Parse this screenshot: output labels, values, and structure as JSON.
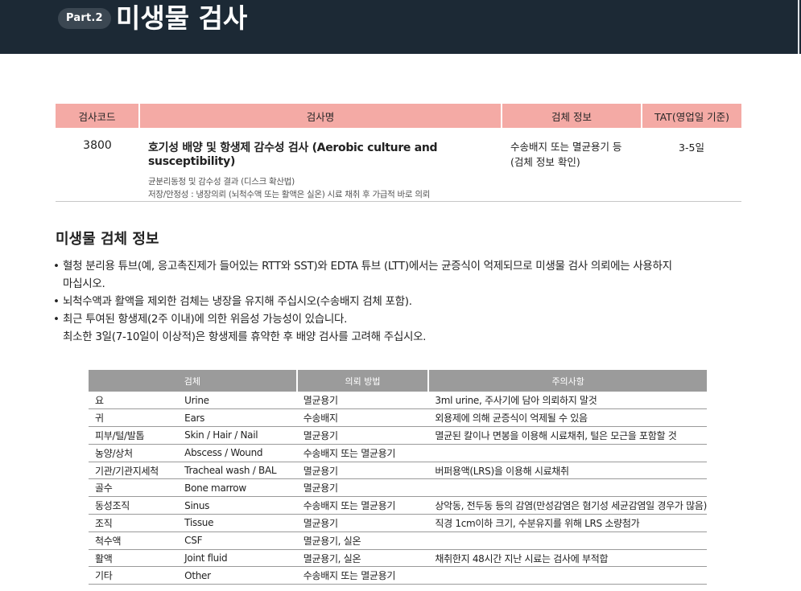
{
  "header": {
    "badge": "Part.2",
    "title": "미생물 검사"
  },
  "test_table": {
    "headers": [
      "검사코드",
      "검사명",
      "검체 정보",
      "TAT(영업일 기준)"
    ],
    "row": {
      "code": "3800",
      "name": "호기성 배양 및 항생제 감수성 검사 (Aerobic culture and susceptibility)",
      "sub1": "균분리동정 및 감수성 결과 (디스크 확산법)",
      "sub2": "저장/안정성 : 냉장의뢰 (뇌척수액 또는 활액은 실온) 시료 채취 후 가급적 바로 의뢰",
      "spec1": "수송배지 또는 멸균용기 등",
      "spec2": "(검체 정보 확인)",
      "tat": "3-5일"
    }
  },
  "section": {
    "heading": "미생물 검체 정보",
    "notes": [
      {
        "bullet": "•",
        "line1": "혈청 분리용 튜브(예, 응고촉진제가 들어있는 RTT와 SST)와 EDTA 튜브 (LTT)에서는 균증식이 억제되므로 미생물 검사 의뢰에는 사용하지",
        "line2": "마십시오."
      },
      {
        "bullet": "•",
        "line1": "뇌척수액과 활액을 제외한 검체는 냉장을 유지해 주십시오(수송배지 검체 포함).",
        "line2": ""
      },
      {
        "bullet": "•",
        "line1": "최근 투여된 항생제(2주 이내)에 의한 위음성 가능성이 있습니다.",
        "line2": "최소한 3일(7-10일이 이상적)은 항생제를 휴약한 후 배양 검사를 고려해 주십시오."
      }
    ]
  },
  "spec_table": {
    "headers": [
      "검체",
      "의뢰 방법",
      "주의사항"
    ],
    "rows": [
      {
        "ko": "요",
        "en": "Urine",
        "method": "멸균용기",
        "note": "3ml urine, 주사기에 담아 의뢰하지 말것"
      },
      {
        "ko": "귀",
        "en": "Ears",
        "method": "수송배지",
        "note": "외용제에 의해 균증식이 억제될 수 있음"
      },
      {
        "ko": "피부/털/발톱",
        "en": "Skin / Hair / Nail",
        "method": "멸균용기",
        "note": "멸균된 칼이나 면봉을 이용해 시료채취, 털은 모근을 포함할 것"
      },
      {
        "ko": "농양/상처",
        "en": "Abscess / Wound",
        "method": "수송배지 또는 멸균용기",
        "note": ""
      },
      {
        "ko": "기관/기관지세척",
        "en": "Tracheal wash / BAL",
        "method": "멸균용기",
        "note": "버퍼용액(LRS)을 이용해 시료채취"
      },
      {
        "ko": "골수",
        "en": "Bone marrow",
        "method": "멸균용기",
        "note": ""
      },
      {
        "ko": "동성조직",
        "en": "Sinus",
        "method": "수송배지 또는 멸균용기",
        "note": "상악동, 전두동 등의 감염(만성감염은 혐기성 세균감염일 경우가 많음)"
      },
      {
        "ko": "조직",
        "en": "Tissue",
        "method": "멸균용기",
        "note": "직경 1cm이하 크기, 수분유지를 위해 LRS 소량첨가"
      },
      {
        "ko": "척수액",
        "en": "CSF",
        "method": "멸균용기, 실온",
        "note": ""
      },
      {
        "ko": "활액",
        "en": "Joint fluid",
        "method": "멸균용기, 실온",
        "note": "채취한지 48시간 지난 시료는 검사에 부적합"
      },
      {
        "ko": "기타",
        "en": "Other",
        "method": "수송배지 또는 멸균용기",
        "note": ""
      }
    ]
  }
}
